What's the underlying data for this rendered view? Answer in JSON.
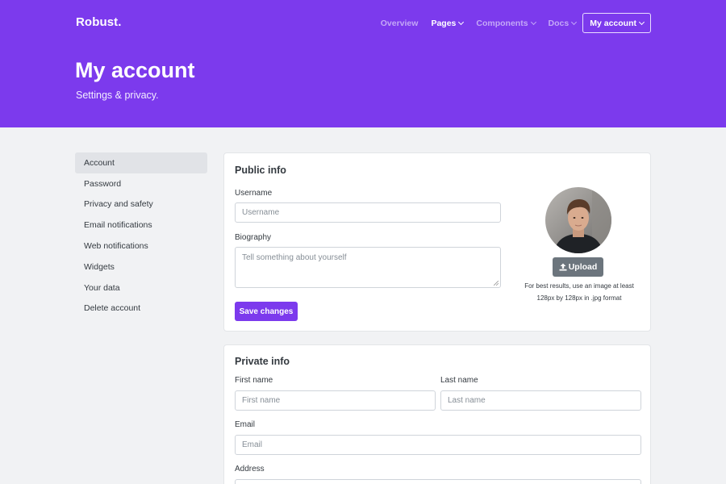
{
  "brand": "Robust.",
  "nav": {
    "overview": "Overview",
    "pages": "Pages",
    "components": "Components",
    "docs": "Docs",
    "account_button": "My account"
  },
  "header": {
    "title": "My account",
    "subtitle": "Settings & privacy."
  },
  "sidebar": {
    "items": [
      {
        "label": "Account",
        "active": true
      },
      {
        "label": "Password"
      },
      {
        "label": "Privacy and safety"
      },
      {
        "label": "Email notifications"
      },
      {
        "label": "Web notifications"
      },
      {
        "label": "Widgets"
      },
      {
        "label": "Your data"
      },
      {
        "label": "Delete account"
      }
    ]
  },
  "public_info": {
    "title": "Public info",
    "username_label": "Username",
    "username_placeholder": "Username",
    "bio_label": "Biography",
    "bio_placeholder": "Tell something about yourself",
    "save_label": "Save changes",
    "upload_label": "Upload",
    "upload_hint_line1": "For best results, use an image at least",
    "upload_hint_line2": "128px by 128px in .jpg format"
  },
  "private_info": {
    "title": "Private info",
    "first_name_label": "First name",
    "first_name_placeholder": "First name",
    "last_name_label": "Last name",
    "last_name_placeholder": "Last name",
    "email_label": "Email",
    "email_placeholder": "Email",
    "address_label": "Address"
  },
  "colors": {
    "primary": "#7c3aed",
    "background": "#f1f2f4",
    "secondary_button": "#6c757d"
  },
  "icons": [
    "chevron-down-icon",
    "upload-icon",
    "resize-grip-icon"
  ]
}
